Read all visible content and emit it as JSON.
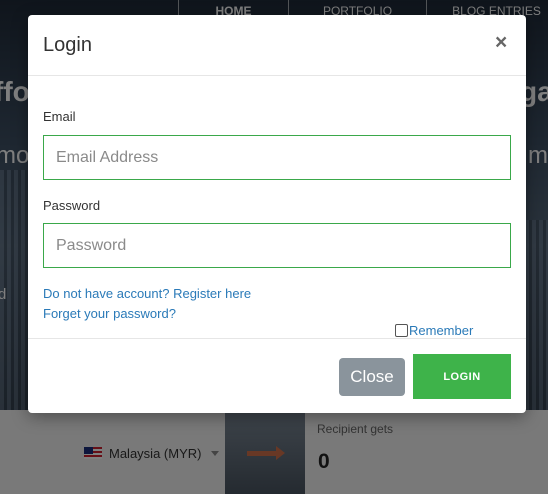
{
  "background": {
    "nav": {
      "home": "HOME",
      "portfolio": "PORTFOLIO",
      "blog": "BLOG ENTRIES"
    },
    "headline_left": "ffo",
    "headline_right": "ga",
    "subline_left": "mo",
    "subline_right": "mit",
    "side_text": "d",
    "converter": {
      "country": "Malaysia (MYR)",
      "recipient_label": "Recipient gets",
      "recipient_value": "0"
    }
  },
  "modal": {
    "title": "Login",
    "close_glyph": "×",
    "email": {
      "label": "Email",
      "placeholder": "Email Address",
      "value": ""
    },
    "password": {
      "label": "Password",
      "placeholder": "Password",
      "value": ""
    },
    "register_link": "Do not have account? Register here",
    "forgot_link": "Forget your password?",
    "remember_label": "Remember",
    "remember_checked": false,
    "buttons": {
      "close": "Close",
      "login": "LOGIN"
    }
  },
  "colors": {
    "accent_green": "#3eb34a",
    "link_blue": "#2a7ab8",
    "close_button_gray": "#8a949c"
  }
}
